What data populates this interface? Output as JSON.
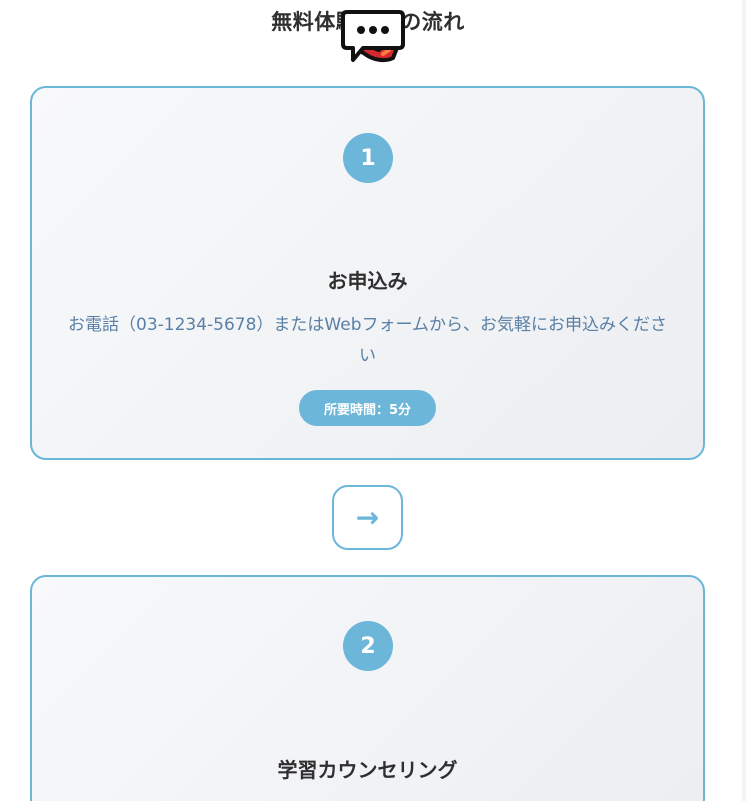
{
  "section": {
    "title": "無料体験授業の流れ"
  },
  "steps": [
    {
      "number": "1",
      "icon": "telephone-receiver-icon",
      "title": "お申込み",
      "description": "お電話（03-1234-5678）またはWebフォームから、お気軽にお申込みください",
      "time": "所要時間：5分"
    },
    {
      "number": "2",
      "icon": "speech-bubble-icon",
      "title": "学習カウンセリング"
    }
  ],
  "connector": {
    "arrow": "→"
  },
  "colors": {
    "accent": "#6cb6d9",
    "heading": "#2f2f2f",
    "description": "#5a80a6",
    "card_bg": "#f4f5f7"
  }
}
